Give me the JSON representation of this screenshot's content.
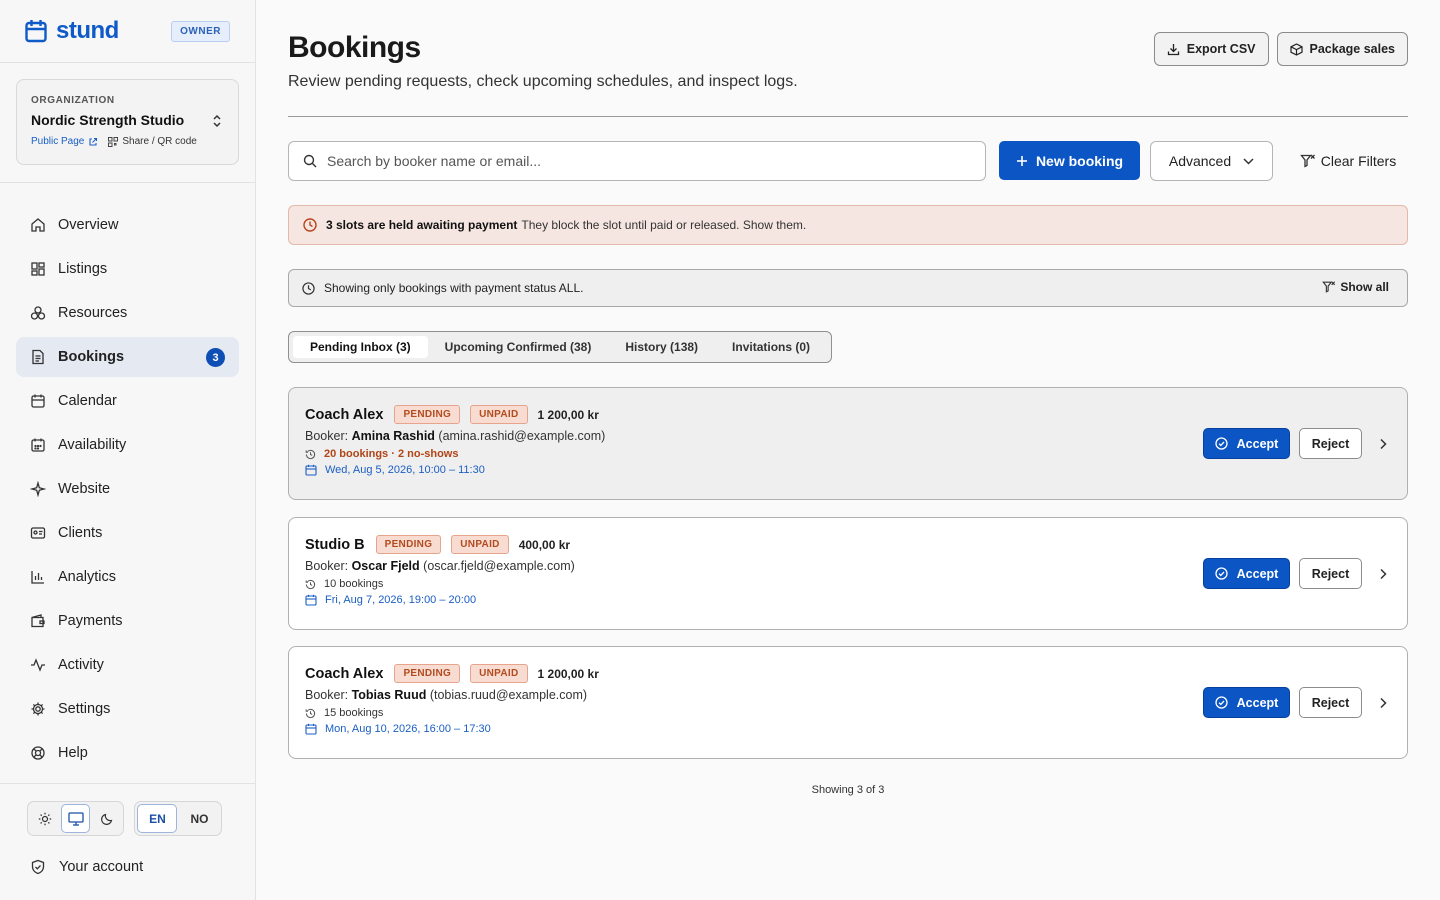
{
  "brand": {
    "name": "stund",
    "role_badge": "OWNER",
    "accent": "#0f5ac8"
  },
  "organization": {
    "label": "ORGANIZATION",
    "name": "Nordic Strength Studio",
    "public_link": "Public Page",
    "share_link": "Share / QR code"
  },
  "nav": {
    "items": [
      {
        "label": "Overview",
        "icon": "home-icon"
      },
      {
        "label": "Listings",
        "icon": "grid-icon"
      },
      {
        "label": "Resources",
        "icon": "resources-icon"
      },
      {
        "label": "Bookings",
        "icon": "document-icon",
        "count": "3",
        "active": true
      },
      {
        "label": "Calendar",
        "icon": "calendar-icon"
      },
      {
        "label": "Availability",
        "icon": "calendar-grid-icon"
      },
      {
        "label": "Website",
        "icon": "sparkles-icon"
      },
      {
        "label": "Clients",
        "icon": "id-card-icon"
      },
      {
        "label": "Analytics",
        "icon": "bar-chart-icon"
      },
      {
        "label": "Payments",
        "icon": "wallet-icon"
      },
      {
        "label": "Activity",
        "icon": "activity-icon"
      },
      {
        "label": "Settings",
        "icon": "gear-icon"
      },
      {
        "label": "Help",
        "icon": "lifebuoy-icon"
      }
    ]
  },
  "preferences": {
    "themes": [
      "light",
      "system",
      "dark"
    ],
    "active_theme": "system",
    "languages": [
      "EN",
      "NO"
    ],
    "active_language": "EN"
  },
  "account": {
    "label": "Your account"
  },
  "page": {
    "title": "Bookings",
    "subtitle": "Review pending requests, check upcoming schedules, and inspect logs.",
    "export_label": "Export CSV",
    "package_label": "Package sales"
  },
  "toolbar": {
    "search_placeholder": "Search by booker name or email...",
    "new_booking_label": "New booking",
    "advanced_label": "Advanced",
    "clear_filters_label": "Clear Filters"
  },
  "alert": {
    "bold": "3 slots are held awaiting payment",
    "text": "They block the slot until paid or released. Show them."
  },
  "filter_note": {
    "text": "Showing only bookings with payment status ALL.",
    "action": "Show all"
  },
  "tabs": [
    {
      "label": "Pending Inbox (3)",
      "active": true
    },
    {
      "label": "Upcoming Confirmed (38)",
      "active": false
    },
    {
      "label": "History (138)",
      "active": false
    },
    {
      "label": "Invitations (0)",
      "active": false
    }
  ],
  "bookings": [
    {
      "service": "Coach Alex",
      "status": "PENDING",
      "payment": "UNPAID",
      "price": "1 200,00 kr",
      "booker_prefix": "Booker:",
      "booker_name": "Amina Rashid",
      "booker_email": "(amina.rashid@example.com)",
      "stats": "20 bookings · 2 no-shows",
      "when": "Wed, Aug 5, 2026, 10:00 – 11:30",
      "accept": "Accept",
      "reject": "Reject"
    },
    {
      "service": "Studio B",
      "status": "PENDING",
      "payment": "UNPAID",
      "price": "400,00 kr",
      "booker_prefix": "Booker:",
      "booker_name": "Oscar Fjeld",
      "booker_email": "(oscar.fjeld@example.com)",
      "stats": "10 bookings",
      "when": "Fri, Aug 7, 2026, 19:00 – 20:00",
      "accept": "Accept",
      "reject": "Reject"
    },
    {
      "service": "Coach Alex",
      "status": "PENDING",
      "payment": "UNPAID",
      "price": "1 200,00 kr",
      "booker_prefix": "Booker:",
      "booker_name": "Tobias Ruud",
      "booker_email": "(tobias.ruud@example.com)",
      "stats": "15 bookings",
      "when": "Mon, Aug 10, 2026, 16:00 – 17:30",
      "accept": "Accept",
      "reject": "Reject"
    }
  ],
  "footer": {
    "count": "Showing 3 of 3"
  }
}
